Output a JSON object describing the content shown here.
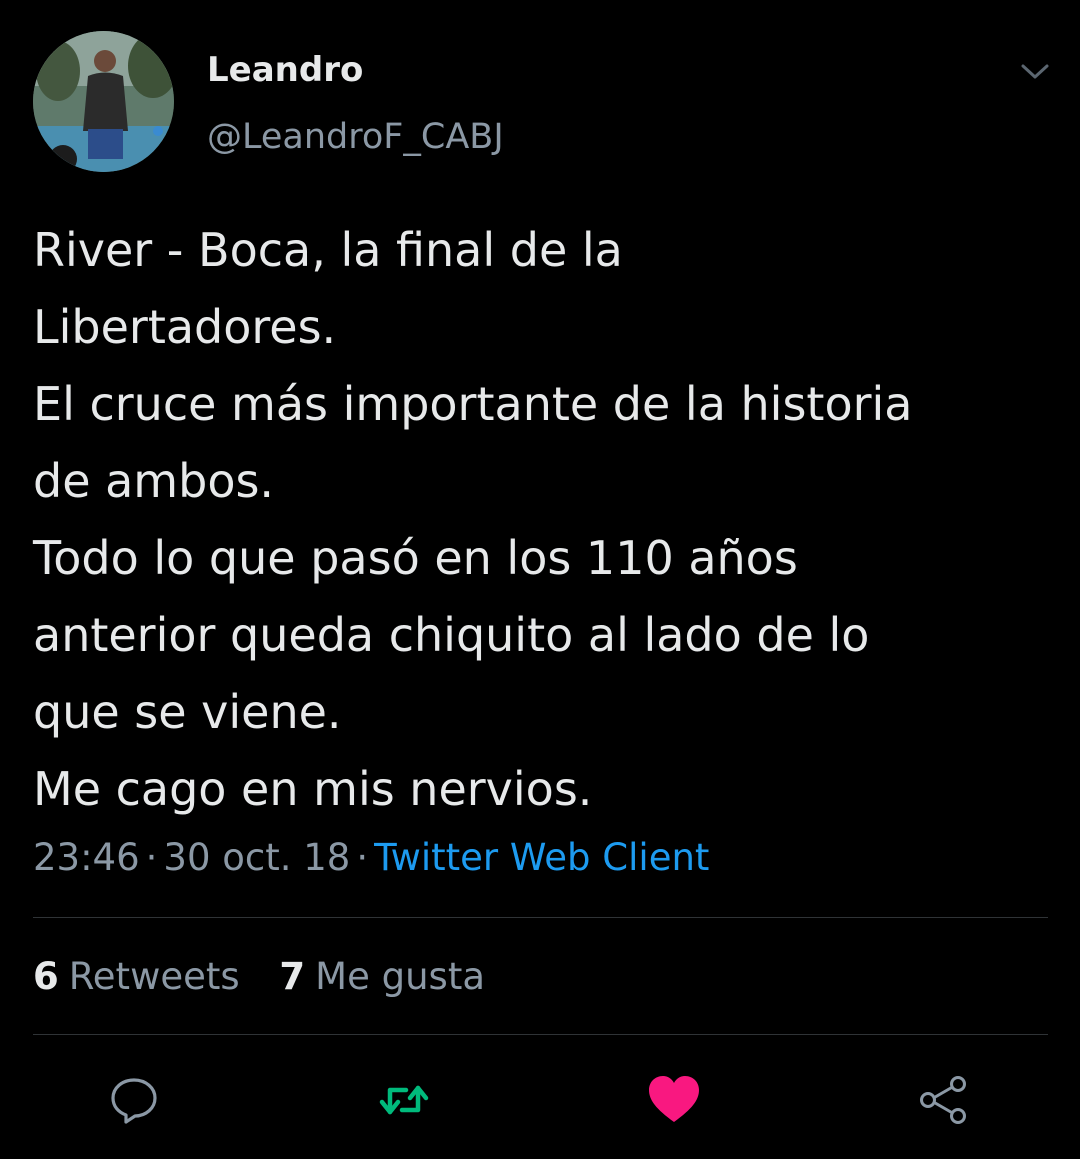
{
  "user": {
    "display_name": "Leandro",
    "handle": "@LeandroF_CABJ",
    "avatar_icon": "profile-photo"
  },
  "tweet": {
    "lines": [
      "River - Boca, la final de la",
      "Libertadores.",
      "El cruce más importante de la historia",
      "de ambos.",
      "Todo lo que pasó en los 110 años",
      "anterior queda chiquito al lado de lo",
      "que se viene.",
      "Me cago en mis nervios."
    ],
    "time": "23:46",
    "date": "30 oct. 18",
    "separator": "·",
    "source": "Twitter Web Client"
  },
  "stats": {
    "retweets_count": "6",
    "retweets_label": "Retweets",
    "likes_count": "7",
    "likes_label": "Me gusta"
  },
  "actions": {
    "reply_icon": "reply-icon",
    "retweet_icon": "retweet-icon",
    "like_icon": "heart-icon",
    "share_icon": "share-icon",
    "retweeted": true,
    "liked": true
  },
  "colors": {
    "background": "#000000",
    "text_primary": "#e7e9ea",
    "text_secondary": "#8b98a5",
    "link": "#1d9bf0",
    "retweet_active": "#00ba7c",
    "like_active": "#f91880",
    "divider": "#2f3336"
  }
}
